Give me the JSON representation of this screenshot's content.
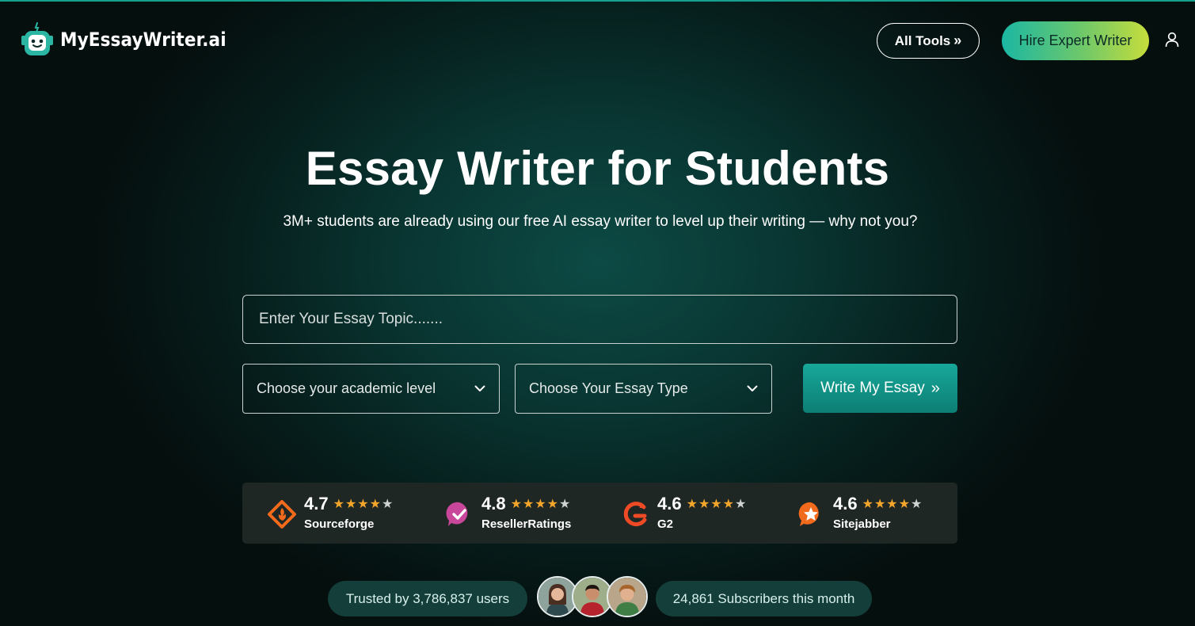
{
  "brand": {
    "name": "MyEssayWriter.ai",
    "accent": "#17a08e"
  },
  "header": {
    "all_tools_label": "All Tools",
    "hire_label": "Hire Expert Writer"
  },
  "hero": {
    "title": "Essay Writer for Students",
    "subtitle": "3M+ students are already using our free AI essay writer to level up their writing — why not you?"
  },
  "form": {
    "topic_placeholder": "Enter Your Essay Topic.......",
    "topic_value": "",
    "level_label": "Choose your academic level",
    "type_label": "Choose Your Essay Type",
    "submit_label": "Write My Essay"
  },
  "ratings": [
    {
      "score": "4.7",
      "stars": 4.5,
      "name": "Sourceforge",
      "icon": "sourceforge-icon"
    },
    {
      "score": "4.8",
      "stars": 4.5,
      "name": "ResellerRatings",
      "icon": "resellerratings-icon"
    },
    {
      "score": "4.6",
      "stars": 4.5,
      "name": "G2",
      "icon": "g2-icon"
    },
    {
      "score": "4.6",
      "stars": 4.5,
      "name": "Sitejabber",
      "icon": "sitejabber-icon"
    }
  ],
  "trust": {
    "users_label": "Trusted by 3,786,837 users",
    "subscribers_label": "24,861 Subscribers this month"
  }
}
